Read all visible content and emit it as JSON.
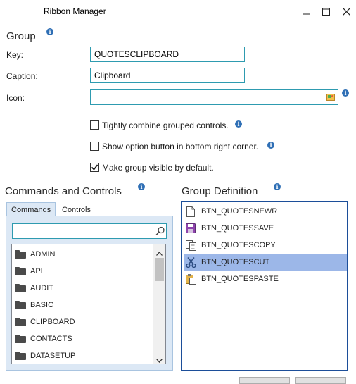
{
  "window": {
    "title": "Ribbon Manager",
    "minimize_glyph": "—",
    "maximize_glyph": "☐",
    "close_glyph": "✕"
  },
  "group": {
    "heading": "Group",
    "key_label": "Key:",
    "key_value": "QUOTESCLIPBOARD",
    "caption_label": "Caption:",
    "caption_value": "Clipboard",
    "icon_label": "Icon:",
    "icon_value": "",
    "options": [
      {
        "label": "Tightly combine grouped controls.",
        "checked": false,
        "has_info": true
      },
      {
        "label": "Show option button in bottom right corner.",
        "checked": false,
        "has_info": true
      },
      {
        "label": "Make group visible by default.",
        "checked": true,
        "has_info": false
      }
    ]
  },
  "commands": {
    "heading": "Commands and Controls",
    "tabs": [
      {
        "label": "Commands",
        "active": true
      },
      {
        "label": "Controls",
        "active": false
      }
    ],
    "search_value": "",
    "items": [
      "ADMIN",
      "API",
      "AUDIT",
      "BASIC",
      "CLIPBOARD",
      "CONTACTS",
      "DATASETUP"
    ]
  },
  "group_definition": {
    "heading": "Group Definition",
    "items": [
      {
        "label": "BTN_QUOTESNEWR",
        "icon": "new-document-icon",
        "selected": false
      },
      {
        "label": "BTN_QUOTESSAVE",
        "icon": "save-icon",
        "selected": false
      },
      {
        "label": "BTN_QUOTESCOPY",
        "icon": "copy-icon",
        "selected": false
      },
      {
        "label": "BTN_QUOTESCUT",
        "icon": "cut-icon",
        "selected": true
      },
      {
        "label": "BTN_QUOTESPASTE",
        "icon": "paste-icon",
        "selected": false
      }
    ]
  },
  "colors": {
    "accent_border": "#2e9bb0",
    "selection": "#9cb7e8",
    "group_def_border": "#1c4e99",
    "info_icon": "#2f6fb5"
  }
}
